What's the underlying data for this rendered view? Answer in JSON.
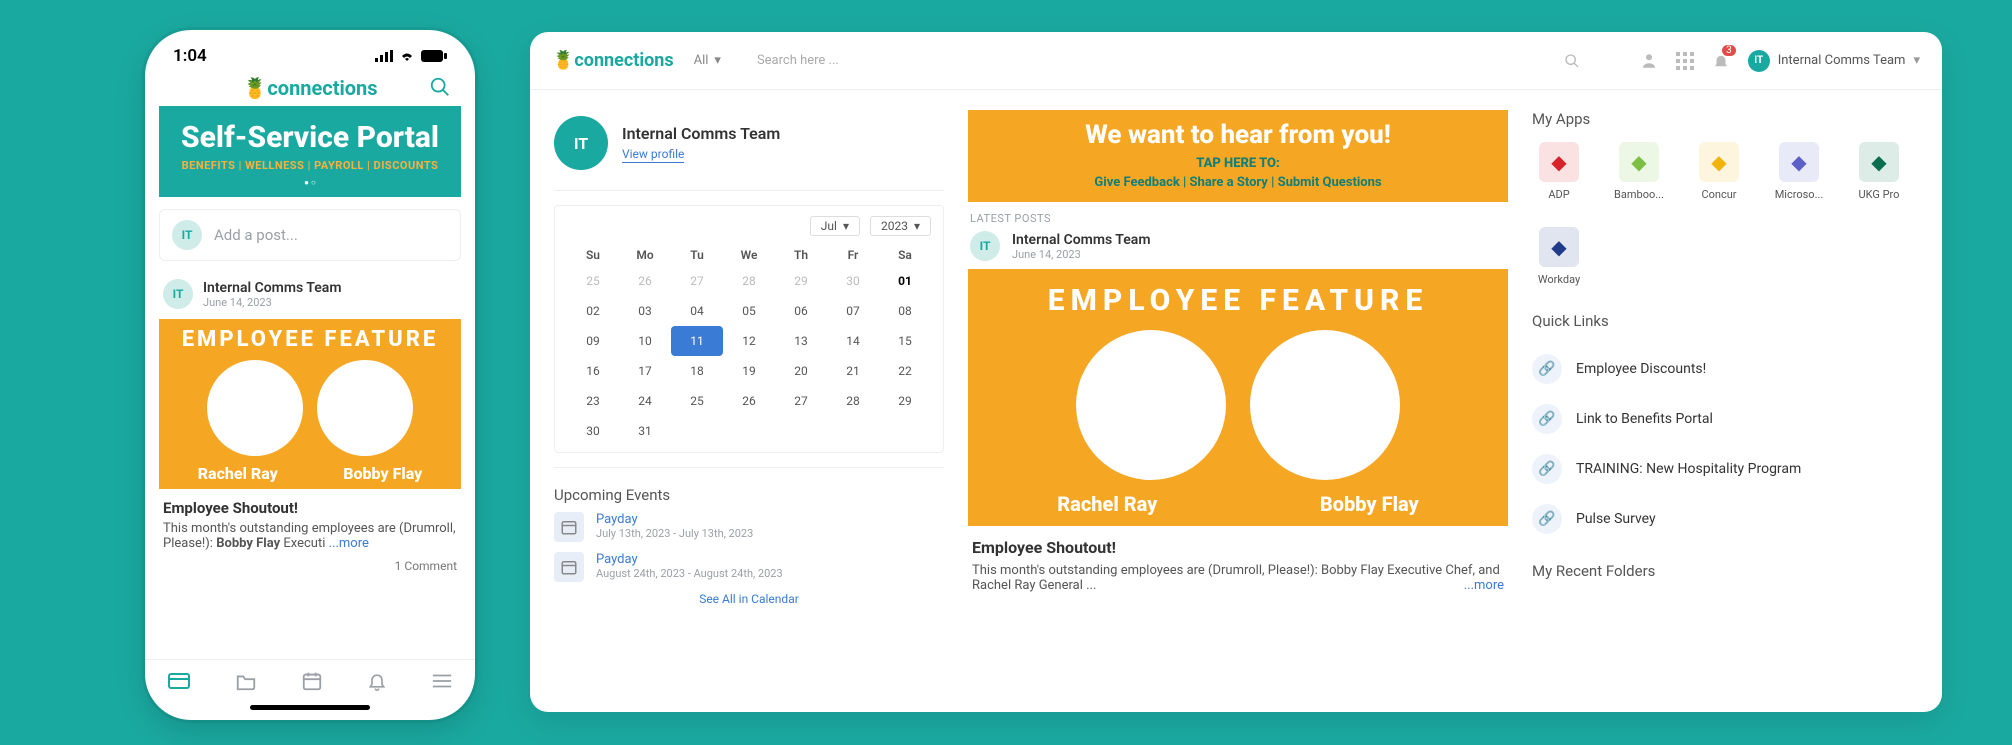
{
  "brand": "connections",
  "phone": {
    "time": "1:04",
    "portal_title": "Self-Service Portal",
    "portal_tags": "BENEFITS  |  WELLNESS  |  PAYROLL  |  DISCOUNTS",
    "addpost_placeholder": "Add a post...",
    "avatar_initials": "IT",
    "post_author": "Internal Comms Team",
    "post_date": "June 14, 2023",
    "feature_title": "EMPLOYEE FEATURE",
    "name1": "Rachel Ray",
    "name2": "Bobby Flay",
    "shout_title": "Employee Shoutout!",
    "shout_body_a": "This month's outstanding employees are (Drumroll, Please!): ",
    "shout_body_bold": "Bobby Flay",
    "shout_body_b": "  Executi  ",
    "more": "...more",
    "comments": "1 Comment"
  },
  "desktop": {
    "all_label": "All",
    "search_placeholder": "Search here ...",
    "notif_count": "3",
    "user_name": "Internal Comms Team",
    "profile_name": "Internal Comms Team",
    "view_profile": "View profile",
    "month_sel": "Jul",
    "year_sel": "2023",
    "dow": [
      "Su",
      "Mo",
      "Tu",
      "We",
      "Th",
      "Fr",
      "Sa"
    ],
    "cal_rows": [
      [
        {
          "d": "25",
          "m": true
        },
        {
          "d": "26",
          "m": true
        },
        {
          "d": "27",
          "m": true
        },
        {
          "d": "28",
          "m": true
        },
        {
          "d": "29",
          "m": true
        },
        {
          "d": "30",
          "m": true
        },
        {
          "d": "01",
          "b": true
        }
      ],
      [
        {
          "d": "02"
        },
        {
          "d": "03"
        },
        {
          "d": "04"
        },
        {
          "d": "05"
        },
        {
          "d": "06"
        },
        {
          "d": "07"
        },
        {
          "d": "08"
        }
      ],
      [
        {
          "d": "09"
        },
        {
          "d": "10"
        },
        {
          "d": "11",
          "t": true
        },
        {
          "d": "12"
        },
        {
          "d": "13"
        },
        {
          "d": "14"
        },
        {
          "d": "15"
        }
      ],
      [
        {
          "d": "16"
        },
        {
          "d": "17"
        },
        {
          "d": "18"
        },
        {
          "d": "19"
        },
        {
          "d": "20"
        },
        {
          "d": "21"
        },
        {
          "d": "22"
        }
      ],
      [
        {
          "d": "23"
        },
        {
          "d": "24"
        },
        {
          "d": "25"
        },
        {
          "d": "26"
        },
        {
          "d": "27"
        },
        {
          "d": "28"
        },
        {
          "d": "29"
        }
      ],
      [
        {
          "d": "30"
        },
        {
          "d": "31"
        },
        {
          "d": "",
          "m": true
        },
        {
          "d": "",
          "m": true
        },
        {
          "d": "",
          "m": true
        },
        {
          "d": "",
          "m": true
        },
        {
          "d": "",
          "m": true
        }
      ]
    ],
    "upcoming_title": "Upcoming Events",
    "events": [
      {
        "name": "Payday",
        "dates": "July 13th, 2023 - July 13th, 2023"
      },
      {
        "name": "Payday",
        "dates": "August 24th, 2023 - August 24th, 2023"
      }
    ],
    "see_all": "See All in Calendar",
    "hear_title": "We want to hear from you!",
    "hear_tap": "TAP HERE TO:",
    "hear_links": "Give Feedback  |  Share a Story  |  Submit Questions",
    "latest": "LATEST POSTS",
    "post_author": "Internal Comms Team",
    "post_date": "June 14, 2023",
    "feature_title": "EMPLOYEE FEATURE",
    "name1": "Rachel Ray",
    "name2": "Bobby Flay",
    "shout_title": "Employee Shoutout!",
    "shout_body": "This month's outstanding employees are (Drumroll, Please!):  Bobby Flay  Executive Chef, and  Rachel Ray  General ...",
    "more": "...more",
    "myapps_title": "My Apps",
    "apps": [
      {
        "label": "ADP",
        "color": "#d8232a"
      },
      {
        "label": "Bamboo...",
        "color": "#7bc043"
      },
      {
        "label": "Concur",
        "color": "#f2b40a"
      },
      {
        "label": "Microso...",
        "color": "#5b5fc7"
      },
      {
        "label": "UKG Pro",
        "color": "#0b6e4f"
      },
      {
        "label": "Workday",
        "color": "#1f3b8a"
      }
    ],
    "ql_title": "Quick Links",
    "ql": [
      "Employee Discounts!",
      "Link to Benefits Portal",
      "TRAINING: New Hospitality Program",
      "Pulse Survey"
    ],
    "folders_title": "My Recent Folders"
  }
}
